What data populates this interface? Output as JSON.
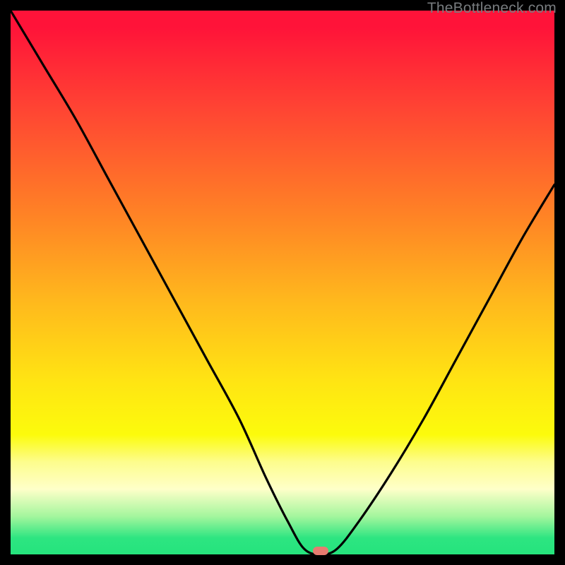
{
  "watermark": "TheBottleneck.com",
  "marker": {
    "x_pct": 57.0,
    "y_pct": 99.3
  },
  "colors": {
    "background": "#000000",
    "curve": "#000000",
    "marker": "#e77b70",
    "watermark": "#777b7e"
  },
  "chart_data": {
    "type": "line",
    "title": "",
    "xlabel": "",
    "ylabel": "",
    "xlim": [
      0,
      100
    ],
    "ylim": [
      0,
      100
    ],
    "series": [
      {
        "name": "bottleneck-curve",
        "x": [
          0,
          6,
          12,
          18,
          24,
          30,
          36,
          42,
          47,
          51,
          54,
          57,
          60,
          64,
          70,
          76,
          82,
          88,
          94,
          100
        ],
        "values": [
          100,
          90,
          80,
          69,
          58,
          47,
          36,
          25,
          14,
          6,
          1,
          0,
          1,
          6,
          15,
          25,
          36,
          47,
          58,
          68
        ]
      }
    ],
    "gradient_stops": [
      {
        "pct": 0,
        "color": "#ff1339"
      },
      {
        "pct": 18,
        "color": "#ff4433"
      },
      {
        "pct": 38,
        "color": "#ff8425"
      },
      {
        "pct": 53,
        "color": "#ffb71d"
      },
      {
        "pct": 68,
        "color": "#ffe413"
      },
      {
        "pct": 78,
        "color": "#fcfb0c"
      },
      {
        "pct": 88,
        "color": "#feffc9"
      },
      {
        "pct": 97,
        "color": "#2de581"
      },
      {
        "pct": 100,
        "color": "#25e47d"
      }
    ]
  }
}
